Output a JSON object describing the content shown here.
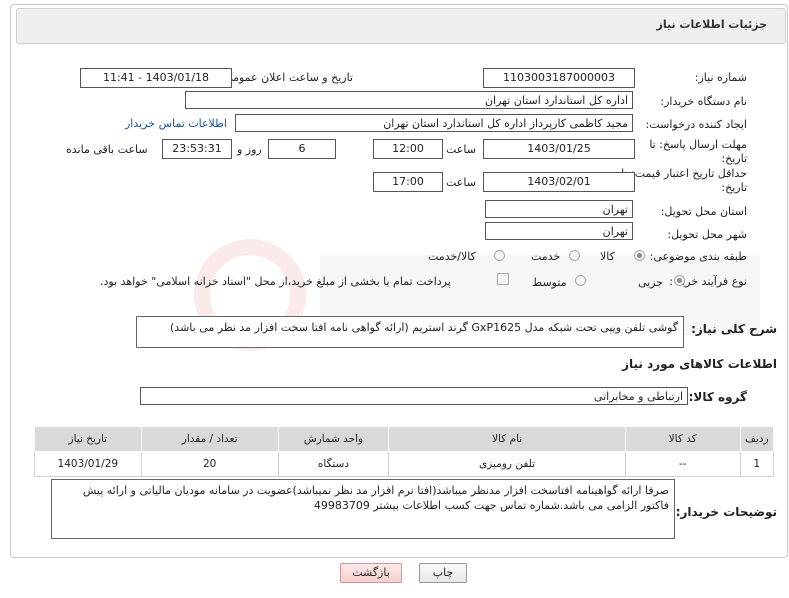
{
  "header": {
    "title": "جزئیات اطلاعات نیاز"
  },
  "form": {
    "need_number": {
      "label": "شماره نیاز:",
      "value": "1103003187000003"
    },
    "announce_datetime": {
      "label": "تاریخ و ساعت اعلان عمومی:",
      "value": "1403/01/18 - 11:41"
    },
    "buyer_org": {
      "label": "نام دستگاه خریدار:",
      "value": "اداره کل استاندارد استان تهران"
    },
    "requester": {
      "label": "ایجاد کننده درخواست:",
      "value": "مجید کاظمی کارپرداز اداره کل استاندارد استان تهران",
      "link": "اطلاعات تماس خریدار"
    },
    "deadline": {
      "label_line1": "مهلت ارسال پاسخ: تا",
      "label_line2": "تاریخ:",
      "date": "1403/01/25",
      "time_label": "ساعت",
      "time": "12:00",
      "days": "6",
      "days_label": "روز و",
      "remaining": "23:53:31",
      "remaining_label": "ساعت باقی مانده"
    },
    "price_validity": {
      "label_line1": "حداقل تاریخ اعتبار قیمت: تا",
      "label_line2": "تاریخ:",
      "date": "1403/02/01",
      "time_label": "ساعت",
      "time": "17:00"
    },
    "delivery_province": {
      "label": "استان محل تحویل:",
      "value": "تهران"
    },
    "delivery_city": {
      "label": "شهر محل تحویل:",
      "value": "تهران"
    },
    "category": {
      "label": "طبقه بندی موضوعی:",
      "options": [
        "کالا",
        "خدمت",
        "کالا/خدمت"
      ],
      "selected": "کالا"
    },
    "purchase_process": {
      "label": "نوع فرآیند خرید :",
      "options": [
        "جزیی",
        "متوسط"
      ],
      "selected": "جزیی",
      "payment_note": "پرداخت تمام یا بخشی از مبلغ خرید،از محل \"اسناد خزانه اسلامی\" خواهد بود."
    }
  },
  "description": {
    "label": "شرح کلی نیاز:",
    "text": "گوشی تلفن ویپی تحت شبکه مدل GxP1625 گرند استریم (ارائه گواهی نامه افتا سخت افزار مد نظر می باشد)"
  },
  "goods_section": {
    "title": "اطلاعات کالاهای مورد نیاز",
    "group_label": "گروه کالا:",
    "group_value": "ارتباطی و مخابراتی",
    "columns": [
      "ردیف",
      "کد کالا",
      "نام کالا",
      "واحد شمارش",
      "تعداد / مقدار",
      "تاریخ نیاز"
    ],
    "rows": [
      [
        "1",
        "--",
        "تلفن رومیزی",
        "دستگاه",
        "20",
        "1403/01/29"
      ]
    ]
  },
  "buyer_notes": {
    "label": "توضیحات خریدار:",
    "text": "صرفا ارائه گواهینامه افتاسخت افزار مدنظر میباشد(افتا نرم افزار مد نظر نمیباشد)عضویت در سامانه مودیان مالیاتی و ارائه پیش فاکتور الزامی می باشد.شماره تماس جهت کسب اطلاعات بیشتر 49983709"
  },
  "buttons": {
    "print": "چاپ",
    "back": "بازگشت"
  },
  "colors": {
    "link": "#1f4fa8",
    "header_bg": "#efefef",
    "table_header_bg": "#d9d9d9",
    "back_button_bg": "#f6cfcf"
  }
}
